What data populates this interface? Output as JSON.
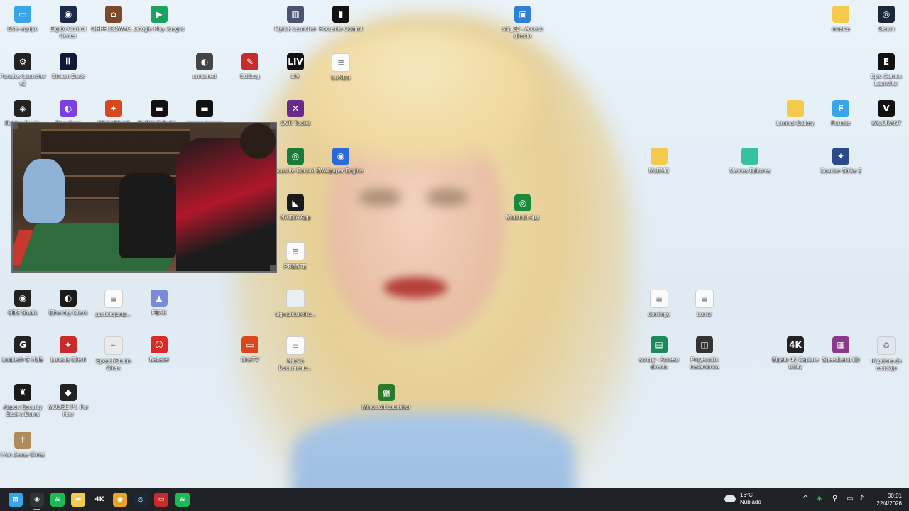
{
  "desktop": {
    "icons": [
      {
        "label": "Este equipo",
        "glyph": "▭",
        "color": "#3aa4e8"
      },
      {
        "label": "Elgato Control Center",
        "glyph": "◉",
        "color": "#1b2a4a"
      },
      {
        "label": "GRFFLSDWAG...",
        "glyph": "⌂",
        "color": "#7a4a2a"
      },
      {
        "label": "Google Play Juegos",
        "glyph": "▶",
        "color": "#1aa260"
      },
      {
        "label": "Mytalk Launcher",
        "glyph": "▥",
        "color": "#4a5470"
      },
      {
        "label": "Focusrite Control",
        "glyph": "▮",
        "color": "#111111"
      },
      {
        "label": "sdr_32 - Acceso directo",
        "glyph": "▣",
        "color": "#2f7fd8"
      },
      {
        "label": "musica",
        "glyph": "",
        "color": "#f4c94c"
      },
      {
        "label": "Steam",
        "glyph": "◎",
        "color": "#1b2838"
      },
      {
        "label": "Paradox Launcher v2",
        "glyph": "⚙",
        "color": "#222222"
      },
      {
        "label": "Stream Deck",
        "glyph": "⠿",
        "color": "#0f1a3a"
      },
      {
        "label": "unnamed",
        "glyph": "◐",
        "color": "#444444"
      },
      {
        "label": "EditLog",
        "glyph": "✎",
        "color": "#c92a2a"
      },
      {
        "label": "LIV",
        "glyph": "LIV",
        "color": "#111111"
      },
      {
        "label": "LUNES",
        "glyph": "≡",
        "color": "#fafafa"
      },
      {
        "label": "Epic Games Launcher",
        "glyph": "E",
        "color": "#111111"
      },
      {
        "label": "Roblox Studio",
        "glyph": "◈",
        "color": "#222222"
      },
      {
        "label": "Blue Sync",
        "glyph": "◐",
        "color": "#7b3fe4"
      },
      {
        "label": "ESCAPE AC",
        "glyph": "✦",
        "color": "#d9481c"
      },
      {
        "label": "SUBNUT Bn24...",
        "glyph": "▬",
        "color": "#111111"
      },
      {
        "label": "stream banner",
        "glyph": "▬",
        "color": "#111111"
      },
      {
        "label": "OVR Toolkit",
        "glyph": "✕",
        "color": "#6a2a8a"
      },
      {
        "label": "Liminal Gallery",
        "glyph": "",
        "color": "#f4c94c"
      },
      {
        "label": "Fortnite",
        "glyph": "F",
        "color": "#3aa4e8"
      },
      {
        "label": "VALORANT",
        "glyph": "V",
        "color": "#111111"
      },
      {
        "label": "Focusrite Control 2",
        "glyph": "◎",
        "color": "#1a7a3a"
      },
      {
        "label": "Wallpaper Engine",
        "glyph": "◉",
        "color": "#2a6ad8"
      },
      {
        "label": "MoBMC",
        "glyph": "",
        "color": "#f4c94c"
      },
      {
        "label": "Memes Editores",
        "glyph": "",
        "color": "#36c2a0"
      },
      {
        "label": "Counter-Strike 2",
        "glyph": "✦",
        "color": "#2a4a8a"
      },
      {
        "label": "NVIDIA App",
        "glyph": "◣",
        "color": "#1a1a1a"
      },
      {
        "label": "Modrinth App",
        "glyph": "◎",
        "color": "#1a8a3a"
      },
      {
        "label": "PRESTE",
        "glyph": "≡",
        "color": "#fafafa"
      },
      {
        "label": "OBS Studio",
        "glyph": "◉",
        "color": "#222222"
      },
      {
        "label": "Ethernity Client",
        "glyph": "◐",
        "color": "#1a1a1a"
      },
      {
        "label": "particlejump...",
        "glyph": "≡",
        "color": "#fafafa"
      },
      {
        "label": "FBAK",
        "glyph": "▲",
        "color": "#7a8ad8"
      },
      {
        "label": "sign.picturefra...",
        "glyph": "",
        "color": "#e8eef2"
      },
      {
        "label": "domingo",
        "glyph": "≡",
        "color": "#fafafa"
      },
      {
        "label": "borrar",
        "glyph": "≡",
        "color": "#fafafa"
      },
      {
        "label": "Logitech G HUB",
        "glyph": "G",
        "color": "#222222"
      },
      {
        "label": "Lunaria Client",
        "glyph": "✦",
        "color": "#c92a2a"
      },
      {
        "label": "SpeechStudio Client",
        "glyph": "~",
        "color": "#eaeaea"
      },
      {
        "label": "Babatel",
        "glyph": "☺",
        "color": "#d92a2a"
      },
      {
        "label": "OneTV",
        "glyph": "▭",
        "color": "#d9481c"
      },
      {
        "label": "Nuevo Documento...",
        "glyph": "≡",
        "color": "#fafafa"
      },
      {
        "label": "scrcpy - Acceso directo",
        "glyph": "▤",
        "color": "#1a8a5a"
      },
      {
        "label": "Proyección inalámbrica",
        "glyph": "◫",
        "color": "#333333"
      },
      {
        "label": "Elgato 4K Capture Utility",
        "glyph": "4K",
        "color": "#222222"
      },
      {
        "label": "SpeedLand (1)",
        "glyph": "▦",
        "color": "#8a3a8a"
      },
      {
        "label": "Papelera de reciclaje",
        "glyph": "♻",
        "color": "#dfe6ee"
      },
      {
        "label": "Airport Security Sack it Demo",
        "glyph": "♜",
        "color": "#1a1a1a"
      },
      {
        "label": "MOUSE P.I. For Hire",
        "glyph": "◆",
        "color": "#222222"
      },
      {
        "label": "Minecraft Launcher",
        "glyph": "▩",
        "color": "#2a7a2a"
      },
      {
        "label": "I Am Jesus Christ",
        "glyph": "✝",
        "color": "#b08a5a"
      }
    ]
  },
  "webcam": {
    "name": "webcam-overlay"
  },
  "taskbar": {
    "apps": [
      {
        "name": "start-button",
        "glyph": "⊞",
        "color": "#3aa4e8"
      },
      {
        "name": "obs-taskbar",
        "glyph": "◉",
        "color": "#333333"
      },
      {
        "name": "spotify-taskbar",
        "glyph": "≋",
        "color": "#1db954"
      },
      {
        "name": "explorer-taskbar",
        "glyph": "▬",
        "color": "#f4c94c"
      },
      {
        "name": "elgato-4k-taskbar",
        "glyph": "4K",
        "color": "#222222"
      },
      {
        "name": "chrome-taskbar",
        "glyph": "●",
        "color": "#e8a42a"
      },
      {
        "name": "steam-taskbar",
        "glyph": "◎",
        "color": "#1b2838"
      },
      {
        "name": "dslr-taskbar",
        "glyph": "▭",
        "color": "#c92a2a"
      },
      {
        "name": "spotify2-taskbar",
        "glyph": "≋",
        "color": "#1db954"
      }
    ],
    "weather": {
      "temp": "16°C",
      "desc": "Nublado"
    },
    "clock": {
      "time": "00:01",
      "date": "22/4/2026"
    },
    "tray": [
      "^",
      "◈",
      "⚲",
      "▭",
      "♪"
    ]
  }
}
